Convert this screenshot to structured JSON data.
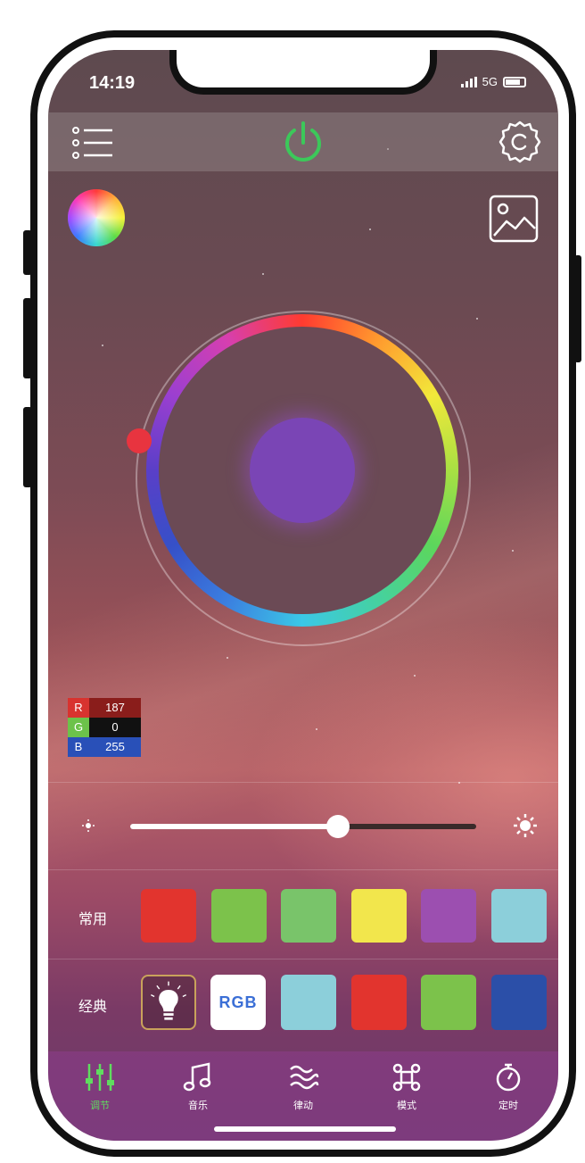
{
  "status_bar": {
    "time": "14:19",
    "network": "5G"
  },
  "header": {
    "menu_icon": "menu-list-icon",
    "power_icon": "power-icon",
    "power_color": "#3cc85a",
    "settings_icon": "gear-icon"
  },
  "wheel": {
    "selected_color": "#7a45b5"
  },
  "rgb": {
    "r_label": "R",
    "r_value": "187",
    "g_label": "G",
    "g_value": "0",
    "b_label": "B",
    "b_value": "255",
    "r_color": "#d8332f",
    "g_color": "#6cc24a",
    "b_color": "#2950b8"
  },
  "brightness": {
    "level": 0.6
  },
  "common": {
    "label": "常用",
    "colors": [
      "#e2342e",
      "#7cc24b",
      "#79c46a",
      "#f2e64c",
      "#9c4fb0",
      "#8ccfda"
    ]
  },
  "classic": {
    "label": "经典",
    "rgb_tile_label": "RGB",
    "colors": [
      "#8ccfda",
      "#e2342e",
      "#7cc24b",
      "#2b4fa8"
    ]
  },
  "nav": {
    "items": [
      {
        "label": "调节",
        "icon": "sliders-icon"
      },
      {
        "label": "音乐",
        "icon": "music-icon"
      },
      {
        "label": "律动",
        "icon": "waves-icon"
      },
      {
        "label": "模式",
        "icon": "command-icon"
      },
      {
        "label": "定时",
        "icon": "timer-icon"
      }
    ],
    "active_color": "#5fdc5f"
  }
}
